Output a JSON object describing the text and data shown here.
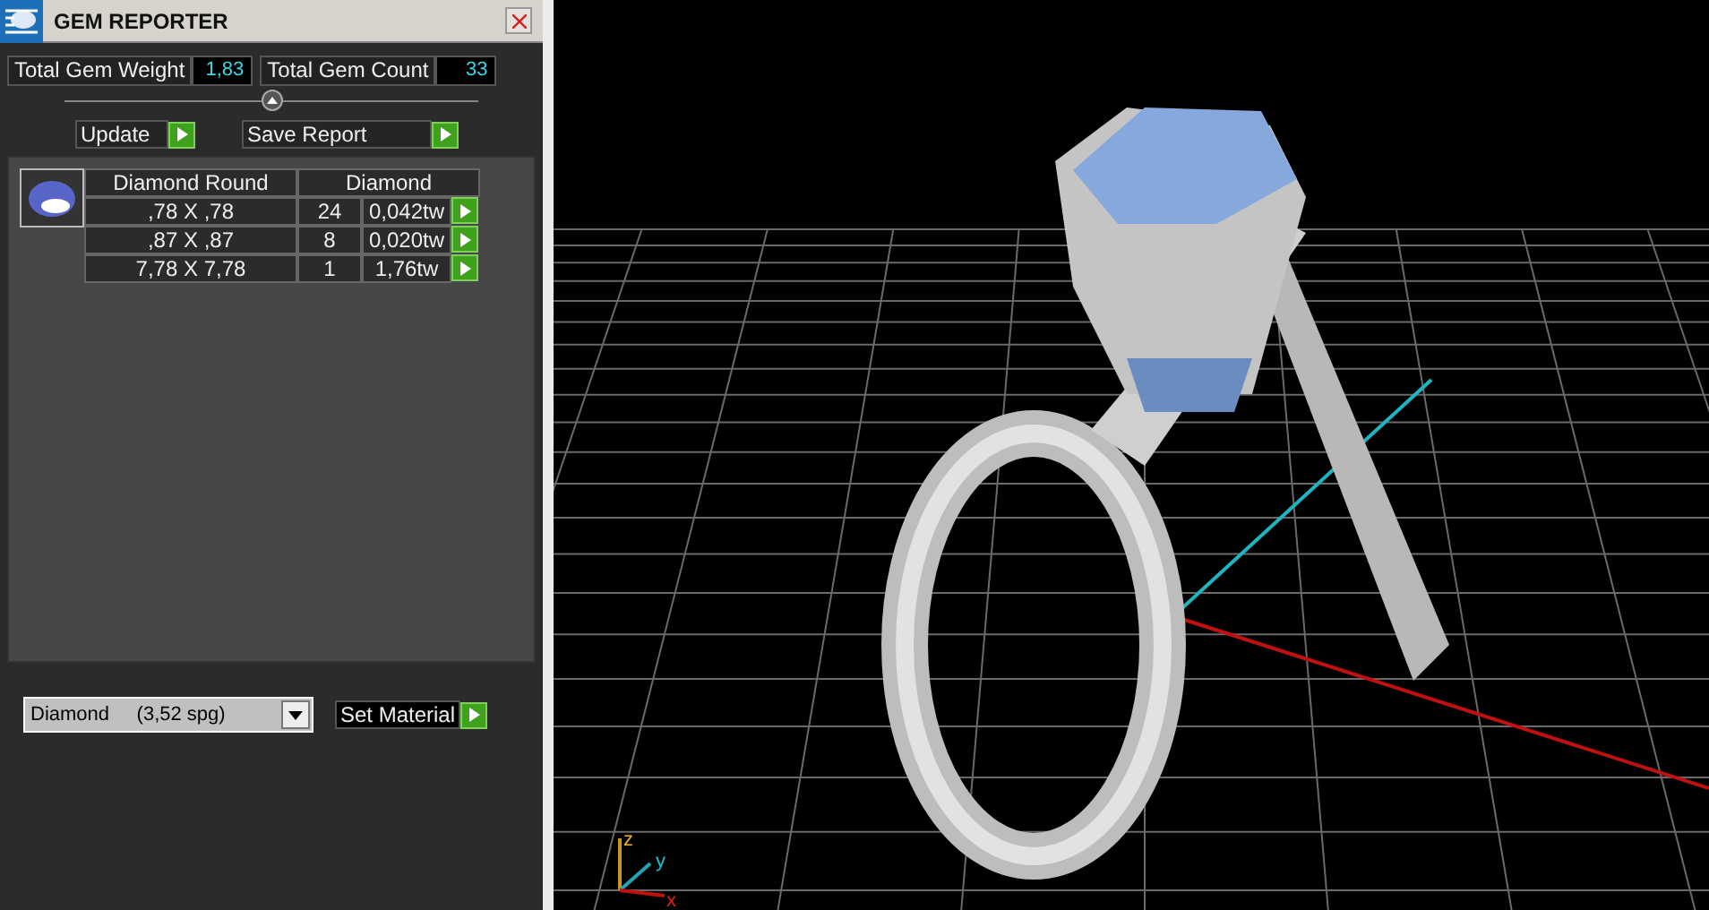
{
  "panel": {
    "title": "GEM REPORTER",
    "stats": [
      {
        "label": "Total Gem Weight",
        "value": "1,83"
      },
      {
        "label": "Total Gem Count",
        "value": "33"
      }
    ],
    "actions": [
      "Update",
      "Save Report"
    ],
    "table": {
      "columns": [
        "Diamond Round",
        "Diamond"
      ],
      "rows": [
        {
          "size": ",78 X ,78",
          "count": "24",
          "weight": "0,042tw"
        },
        {
          "size": ",87 X ,87",
          "count": "8",
          "weight": "0,020tw"
        },
        {
          "size": "7,78 X 7,78",
          "count": "1",
          "weight": "1,76tw"
        }
      ]
    },
    "material": {
      "value": "Diamond     (3,52 spg)",
      "button": "Set Material"
    }
  },
  "viewport": {
    "axes": {
      "x": "x",
      "y": "y",
      "z": "z"
    }
  }
}
